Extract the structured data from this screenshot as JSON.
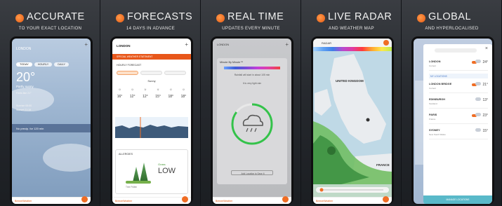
{
  "brand": {
    "accent": "#f06d24",
    "logo_text": "BreezeWeather"
  },
  "panels": [
    {
      "title": "ACCURATE",
      "subtitle": "TO YOUR EXACT LOCATION",
      "screen": {
        "location": "LONDON",
        "tabs": [
          "TODAY",
          "HOURLY",
          "DAILY"
        ],
        "temperature": "20°",
        "condition": "Partly sunny",
        "details": [
          "Feels like 21°",
          "Sunrise 05:00",
          "Sunset 21:19"
        ],
        "rain_alert": "No precip. for 120 min"
      }
    },
    {
      "title": "FORECASTS",
      "subtitle": "14 DAYS IN ADVANCE",
      "screen": {
        "location": "LONDON",
        "banner": "SPECIAL WEATHER STATEMENT",
        "section": "HOURLY FORECAST",
        "condition": "Sunny",
        "temps": [
          "16°",
          "12°",
          "12°",
          "15°",
          "18°",
          "18°"
        ],
        "pollen_title": "ALLERGIES",
        "pollen_type": "Grass",
        "pollen_level": "LOW",
        "pollen_caption": "Tree Pollen"
      }
    },
    {
      "title": "REAL TIME",
      "subtitle": "UPDATES EVERY MINUTE",
      "screen": {
        "location": "LONDON",
        "card_title": "Minute By Minute™",
        "line1": "Rainfall will start in about 105 min",
        "line2": "It is very light rain",
        "button": "Add Location to Save It"
      }
    },
    {
      "title": "LIVE RADAR",
      "subtitle": "AND WEATHER MAP",
      "screen": {
        "layer": "RADAR",
        "country_top": "UNITED KINGDOM",
        "country_bottom": "FRANCE"
      }
    },
    {
      "title": "GLOBAL",
      "subtitle": "AND HYPERLOCALISED",
      "screen": {
        "locations": [
          {
            "name": "LONDON",
            "detail": "Current",
            "temp": "24°"
          },
          {
            "name": "LONDON BRIDGE",
            "detail": "Current",
            "temp": "21°"
          },
          {
            "name": "EDINBURGH",
            "detail": "Scotland",
            "temp": "13°"
          },
          {
            "name": "PARIS",
            "detail": "France",
            "temp": "23°"
          },
          {
            "name": "SYDNEY",
            "detail": "New South Wales",
            "temp": "15°"
          }
        ],
        "section": "MY LOCATIONS",
        "footer": "MANAGE LOCATIONS"
      }
    }
  ]
}
